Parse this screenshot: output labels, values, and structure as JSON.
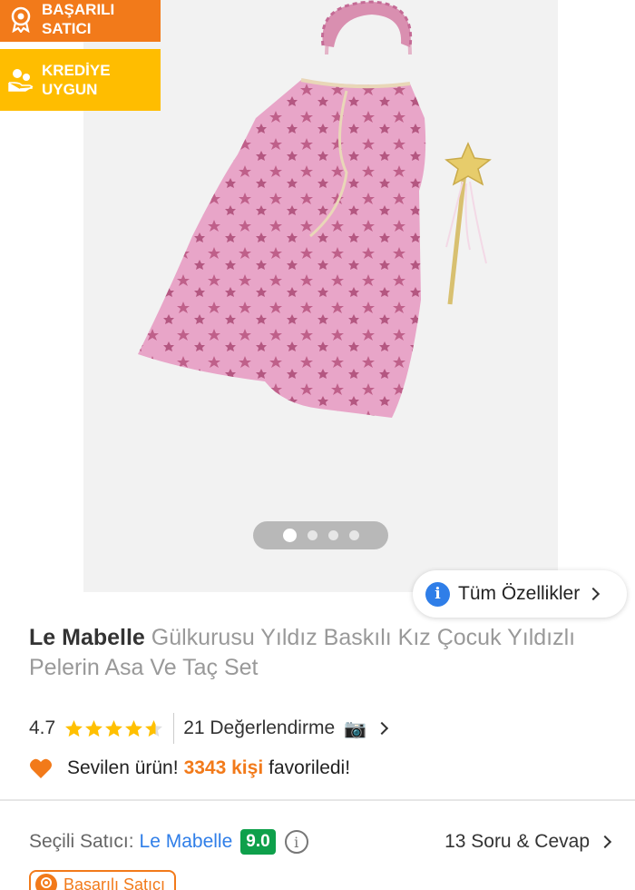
{
  "badges": {
    "top": {
      "label": "BAŞARILI\nSATICI",
      "icon": "medal-icon"
    },
    "credit": {
      "label": "KREDİYE\nUYGUN",
      "icon": "hand-coins-icon"
    }
  },
  "gallery": {
    "total_images": 4,
    "active_index": 0,
    "image_subject": "pink star tulle cape, ruffled headband, gold star wand"
  },
  "all_features": {
    "label": "Tüm Özellikler",
    "icon": "info-icon"
  },
  "product": {
    "brand": "Le Mabelle",
    "name": "Gülkurusu Yıldız Baskılı Kız Çocuk Yıldızlı Pelerin Asa Ve Taç Set"
  },
  "rating": {
    "value": "4.7",
    "stars": 4.7,
    "reviews_label": "21 Değerlendirme",
    "star_color": "#ffc000"
  },
  "favorites": {
    "prefix": "Sevilen ürün!",
    "count": "3343 kişi",
    "suffix": "favoriledi!"
  },
  "seller": {
    "label": "Seçili Satıcı:",
    "name": "Le Mabelle",
    "score": "9.0",
    "badge": "Başarılı Satıcı"
  },
  "qa": {
    "label": "13 Soru & Cevap"
  },
  "colors": {
    "orange": "#f27a1a",
    "yellow": "#ffbd00",
    "blue": "#2f7ee8",
    "green": "#0ea04b"
  }
}
